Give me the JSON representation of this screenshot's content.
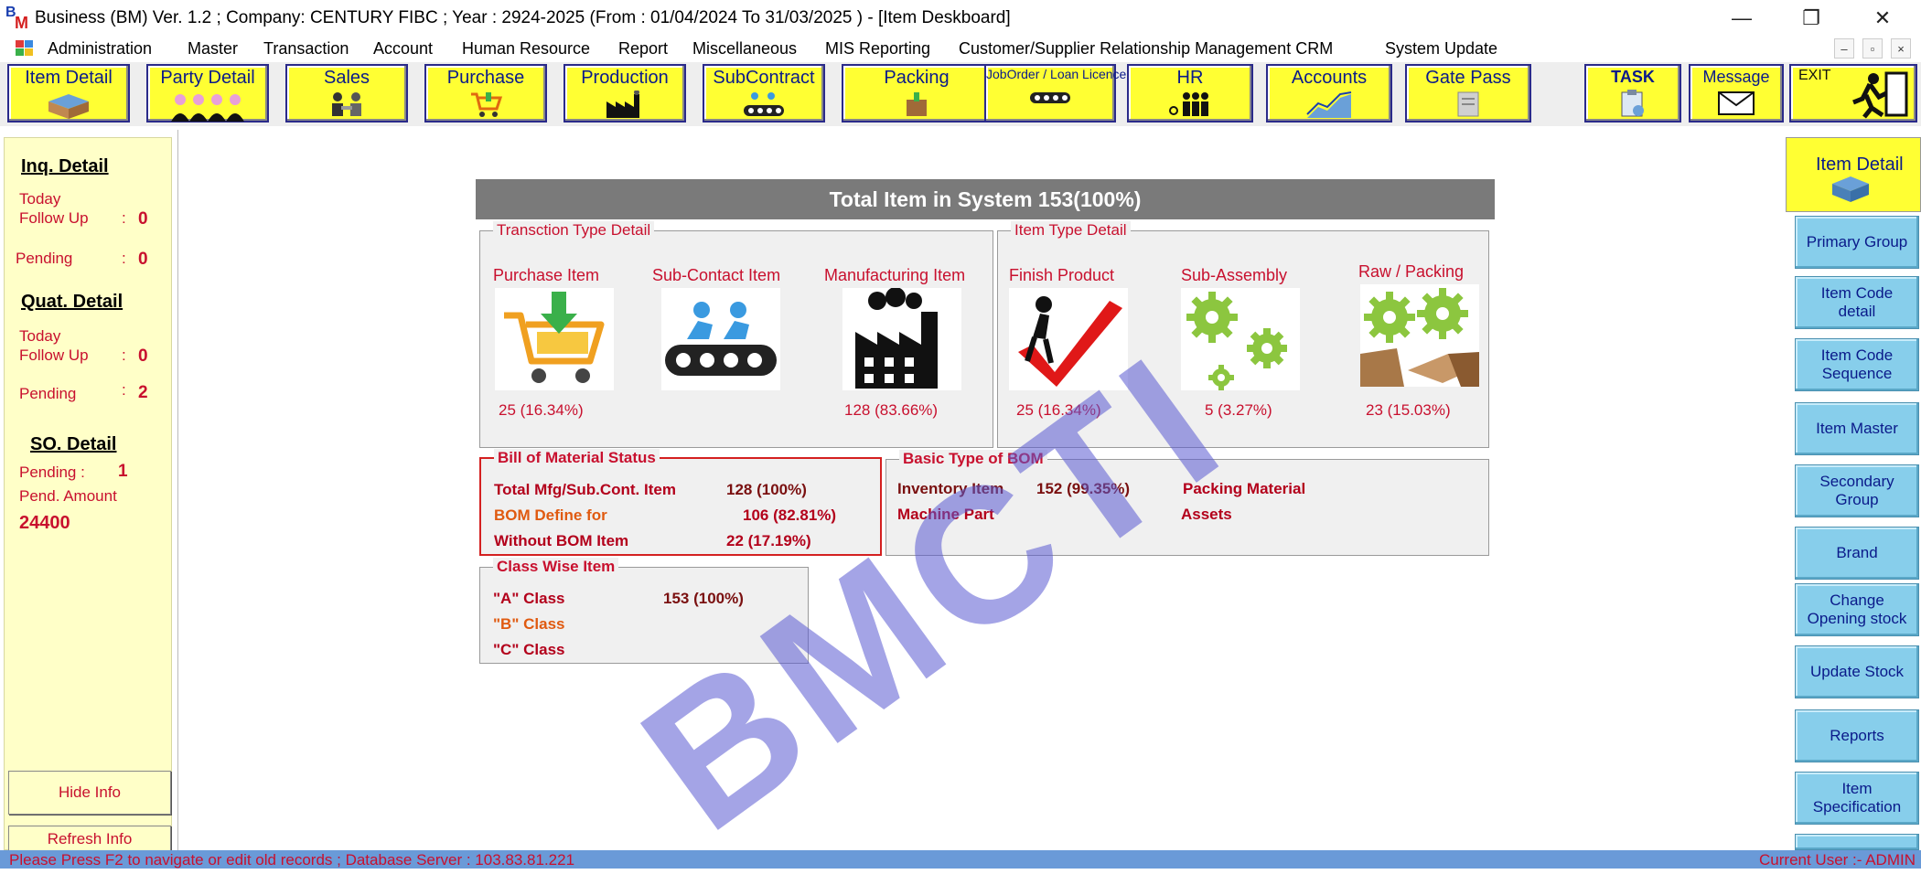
{
  "window": {
    "title": "Business (BM) Ver. 1.2 ; Company: CENTURY FIBC ; Year : 2924-2025  (From : 01/04/2024 To 31/03/2025 ) - [Item Deskboard]",
    "minimize": "—",
    "restore": "❐",
    "close": "✕"
  },
  "menu": {
    "items": [
      "Administration",
      "Master",
      "Transaction",
      "Account",
      "Human Resource",
      "Report",
      "Miscellaneous",
      "MIS Reporting",
      "Customer/Supplier Relationship Management CRM",
      "System Update"
    ],
    "mdi_buttons": [
      "–",
      "▫",
      "×"
    ]
  },
  "toolbar": {
    "buttons": [
      "Item Detail",
      "Party Detail",
      "Sales",
      "Purchase",
      "Production",
      "SubContract",
      "Packing",
      "JobOrder / Loan Licence",
      "HR",
      "Accounts",
      "Gate Pass"
    ],
    "task": "TASK",
    "message": "Message",
    "exit": "EXIT"
  },
  "left_panel": {
    "inq": {
      "title": "Inq. Detail",
      "today_follow_up_label": "Today Follow Up",
      "today_follow_up": "0",
      "pending_label": "Pending",
      "pending": "0"
    },
    "quat": {
      "title": "Quat. Detail",
      "today_follow_up_label": "Today Follow Up",
      "today_follow_up": "0",
      "pending_label": "Pending",
      "pending": "2"
    },
    "so": {
      "title": "SO. Detail",
      "pending_label": "Pending :",
      "pending": "1",
      "pend_amount_label": "Pend. Amount",
      "pend_amount": "24400"
    },
    "colon": ":",
    "hide_info": "Hide Info",
    "refresh_info": "Refresh Info"
  },
  "dashboard": {
    "header": "Total Item in System 153(100%)",
    "transaction_type": {
      "legend": "Transction Type Detail",
      "items": [
        {
          "label": "Purchase Item",
          "value": "25  (16.34%)"
        },
        {
          "label": "Sub-Contact Item",
          "value": ""
        },
        {
          "label": "Manufacturing Item",
          "value": "128  (83.66%)"
        }
      ]
    },
    "item_type": {
      "legend": "Item Type Detail",
      "items": [
        {
          "label": "Finish Product",
          "value": "25  (16.34%)"
        },
        {
          "label": "Sub-Assembly",
          "value": "5  (3.27%)"
        },
        {
          "label": "Raw / Packing",
          "value": "23  (15.03%)"
        }
      ]
    },
    "bom_status": {
      "legend": "Bill of Material Status",
      "rows": [
        {
          "label": "Total Mfg/Sub.Cont. Item",
          "value": "128  (100%)"
        },
        {
          "label": "BOM Define for",
          "value": "106  (82.81%)"
        },
        {
          "label": "Without BOM Item",
          "value": "22  (17.19%)"
        }
      ]
    },
    "basic_bom": {
      "legend": "Basic Type of BOM",
      "inventory_label": "Inventory Item",
      "inventory_value": "152  (99.35%)",
      "packing_label": "Packing Material",
      "machine_label": "Machine Part",
      "assets_label": "Assets"
    },
    "class_wise": {
      "legend": "Class Wise Item",
      "rows": [
        {
          "label": "\"A\" Class",
          "value": "153  (100%)"
        },
        {
          "label": "\"B\" Class",
          "value": ""
        },
        {
          "label": "\"C\" Class",
          "value": ""
        }
      ]
    }
  },
  "right_panel": {
    "header": "Item Detail",
    "buttons": [
      "Primary Group",
      "Item Code\ndetail",
      "Item Code\nSequence",
      "Item Master",
      "Secondary\nGroup",
      "Brand",
      "Change\nOpening stock",
      "Update Stock",
      "Reports",
      "Item\nSpecification"
    ]
  },
  "status": {
    "left": "Please Press F2  to navigate or edit old records ; Database Server : 103.83.81.221",
    "right": "Current User :- ADMIN"
  },
  "watermark": "BMCTI",
  "colors": {
    "toolbar_yellow": "#ffff33",
    "panel_yellow": "#ffffc8",
    "sky_button": "#87ceeb",
    "text_red": "#c8102e",
    "header_gray": "#7a7a7a",
    "status_blue": "#6a9ad8"
  }
}
